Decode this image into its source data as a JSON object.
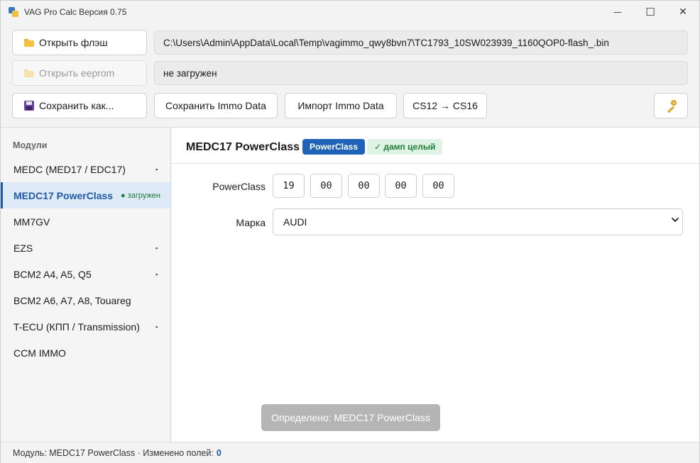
{
  "window": {
    "title": "VAG Pro Calc Версия 0.75",
    "minimize": "—",
    "maximize": "☐",
    "close": "✕"
  },
  "toolbar": {
    "open_flash_label": "Открыть флэш",
    "flash_path": "C:\\Users\\Admin\\AppData\\Local\\Temp\\vagimmo_qwy8bvn7\\TC1793_10SW023939_1160QOP0-flash_.bin",
    "open_eeprom_label": "Открыть eeprom",
    "eeprom_path": "не загружен",
    "save_as_label": "Сохранить как...",
    "save_immo_label": "Сохранить Immo Data",
    "import_immo_label": "Импорт Immo Data",
    "cs_convert_label": "CS12 → CS16"
  },
  "sidebar": {
    "header": "Модули",
    "items": [
      {
        "label": "MEDC (MED17 / EDC17)",
        "has_submenu": true
      },
      {
        "label": "MEDC17 PowerClass",
        "active": true,
        "status": "● загружен"
      },
      {
        "label": "MM7GV"
      },
      {
        "label": "EZS",
        "has_submenu": true
      },
      {
        "label": "BCM2 A4, A5, Q5",
        "has_submenu": true
      },
      {
        "label": "BCM2 A6, A7, A8, Touareg"
      },
      {
        "label": "T-ECU (КПП / Transmission)",
        "has_submenu": true
      },
      {
        "label": "CCM IMMO"
      }
    ],
    "submenu_arrow": "▸"
  },
  "main": {
    "title": "MEDC17 PowerClass",
    "module_badge": "PowerClass",
    "dump_status": "✓ дамп целый",
    "powerclass_label": "PowerClass",
    "powerclass_bytes": [
      "19",
      "00",
      "00",
      "00",
      "00"
    ],
    "brand_label": "Марка",
    "brand_value": "AUDI",
    "detected_label": "Определено: MEDC17 PowerClass"
  },
  "status": {
    "text": "Модуль: MEDC17 PowerClass · Изменено полей:",
    "changed_count": "0"
  },
  "colors": {
    "accent": "#1f5aa6",
    "badge_blue": "#1f63b8",
    "success": "#1e7c3a",
    "success_bg": "#dff3e4",
    "active_bg": "#deeaf7"
  }
}
